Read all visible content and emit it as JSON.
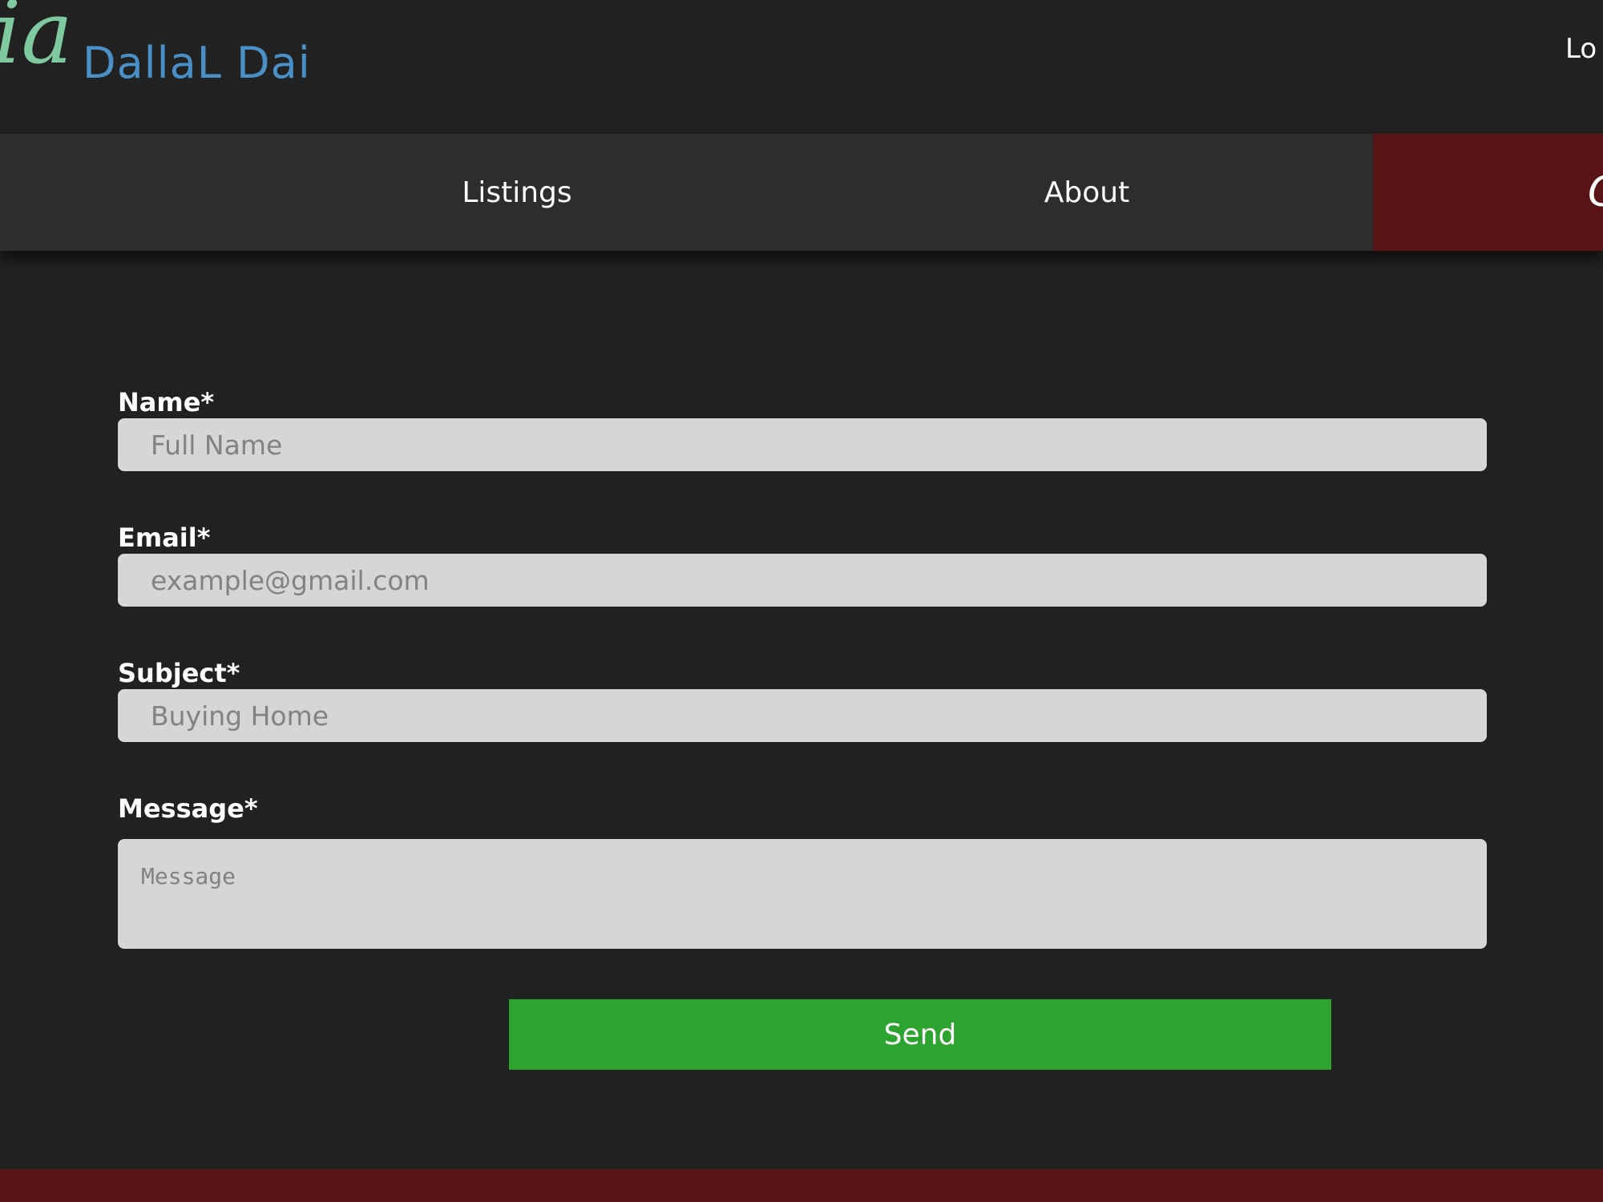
{
  "header": {
    "logo_mark": "ia",
    "brand": "DallaL Dai",
    "login": "Lo"
  },
  "nav": {
    "items": [
      {
        "label": "Listings"
      },
      {
        "label": "About"
      },
      {
        "label": "C",
        "active": true
      }
    ]
  },
  "form": {
    "name_label": "Name*",
    "name_placeholder": "Full Name",
    "email_label": "Email*",
    "email_placeholder": "example@gmail.com",
    "subject_label": "Subject*",
    "subject_placeholder": "Buying Home",
    "message_label": "Message*",
    "message_placeholder": "Message",
    "send_label": "Send"
  },
  "colors": {
    "background": "#212121",
    "navbar": "#2d2d2d",
    "accent_dark_red": "#5a1315",
    "brand_blue": "#4a90c8",
    "logo_green": "#7ec9a0",
    "field_bg": "#d6d6d6",
    "send_green": "#2da42f"
  }
}
